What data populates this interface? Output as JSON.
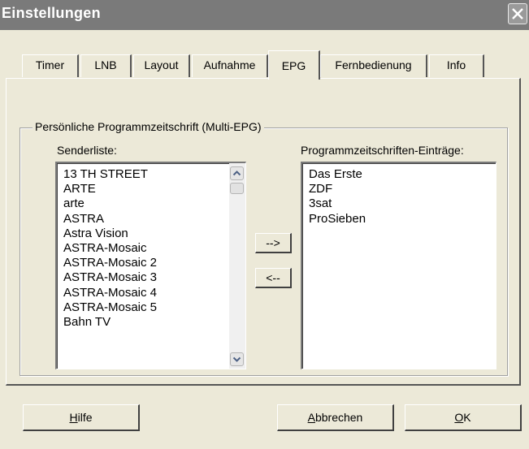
{
  "window": {
    "title": "Einstellungen"
  },
  "tabs": [
    {
      "label": "Timer",
      "active": false
    },
    {
      "label": "LNB",
      "active": false
    },
    {
      "label": "Layout",
      "active": false
    },
    {
      "label": "Aufnahme",
      "active": false
    },
    {
      "label": "EPG",
      "active": true
    },
    {
      "label": "Fernbedienung",
      "active": false
    },
    {
      "label": "Info",
      "active": false
    }
  ],
  "epg": {
    "group_title": "Persönliche Programmzeitschrift (Multi-EPG)",
    "sender_label": "Senderliste:",
    "entries_label": "Programmzeitschriften-Einträge:",
    "senders": [
      "13 TH STREET",
      "ARTE",
      "arte",
      "ASTRA",
      "Astra Vision",
      "ASTRA-Mosaic",
      "ASTRA-Mosaic 2",
      "ASTRA-Mosaic 3",
      "ASTRA-Mosaic 4",
      "ASTRA-Mosaic 5",
      "Bahn TV"
    ],
    "entries": [
      "Das Erste",
      "ZDF",
      "3sat",
      "ProSieben"
    ],
    "add_button": "-->",
    "remove_button": "<--"
  },
  "footer": {
    "help_mnemonic": "H",
    "help_rest": "ilfe",
    "cancel_mnemonic": "A",
    "cancel_rest": "bbrechen",
    "ok_mnemonic": "O",
    "ok_rest": "K"
  }
}
